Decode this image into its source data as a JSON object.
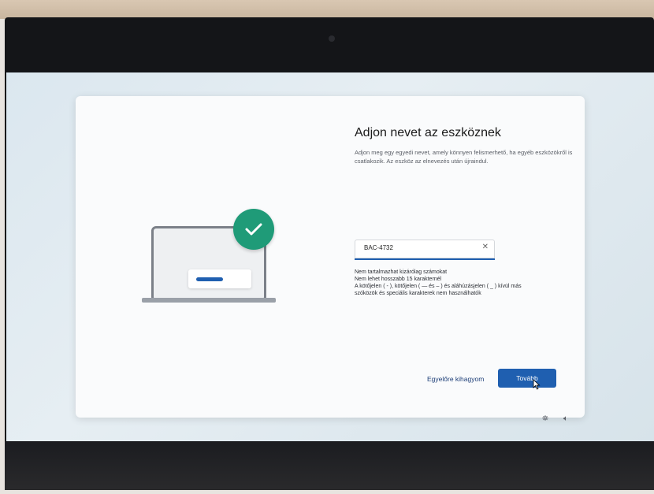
{
  "header": {
    "title": "Adjon nevet az eszköznek",
    "description": "Adjon meg egy egyedi nevet, amely könnyen felismerhető, ha egyéb eszközökről is csatlakozik. Az eszköz az elnevezés után újraindul."
  },
  "device_name": {
    "value": "BAC-4732",
    "clear_glyph": "✕"
  },
  "rules": [
    "Nem tartalmazhat kizárólag számokat",
    "Nem lehet hosszabb 15 karakternél",
    "A kötőjelen ( - ), kötőjelen ( — és – ) és aláhúzásjelen ( _ ) kívül más",
    "szóközök és speciális karakterek nem használhatók"
  ],
  "buttons": {
    "skip": "Egyelőre kihagyom",
    "next": "Tovább"
  },
  "tray": {
    "accessibility_glyph": "⛯",
    "volume_glyph": "🔈︎"
  },
  "colors": {
    "accent": "#1f5fb0",
    "check": "#1f9b78"
  },
  "icons": [
    "laptop-illustration",
    "checkmark-icon",
    "clear-icon",
    "accessibility-icon",
    "volume-icon"
  ]
}
